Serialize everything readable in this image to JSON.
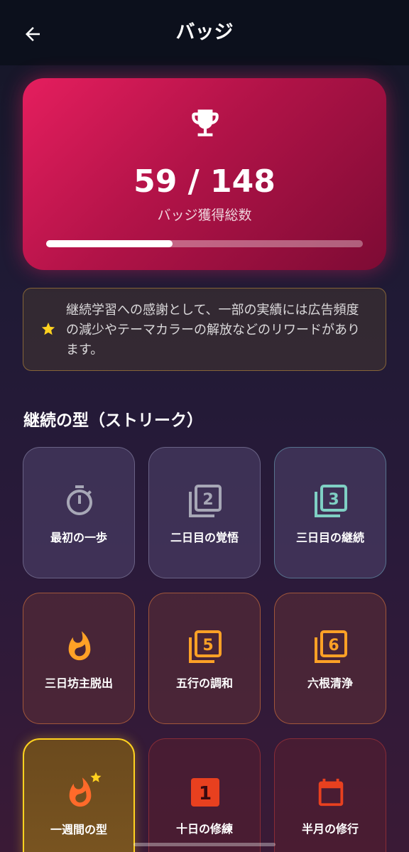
{
  "appbar": {
    "title": "バッジ",
    "back_icon": "arrow-left-icon"
  },
  "summary": {
    "icon": "trophy-icon",
    "count_text": "59 / 148",
    "earned": 59,
    "total": 148,
    "caption": "バッジ獲得総数",
    "progress": 0.4
  },
  "notice": {
    "icon": "star-icon",
    "text": "継続学習への感謝として、一部の実績には広告頻度の減少やテーマカラーの解放などのリワードがあります。"
  },
  "section": {
    "title": "継続の型（ストリーク）"
  },
  "badges": [
    {
      "label": "最初の一歩",
      "icon": "stopwatch-icon",
      "color": "#a7a7b6"
    },
    {
      "label": "二日目の覚悟",
      "icon": "filter-2-icon",
      "color": "#a7a7b6"
    },
    {
      "label": "三日目の継続",
      "icon": "filter-3-icon",
      "color": "#7fd0c4"
    },
    {
      "label": "三日坊主脱出",
      "icon": "flame-icon",
      "color": "#ffa126"
    },
    {
      "label": "五行の調和",
      "icon": "filter-5-icon",
      "color": "#ffa126"
    },
    {
      "label": "六根清浄",
      "icon": "filter-6-icon",
      "color": "#ffa126"
    },
    {
      "label": "一週間の型",
      "icon": "flame-star-icon",
      "color": "#ff6a2a"
    },
    {
      "label": "十日の修練",
      "icon": "calendar-1-icon",
      "color": "#e8401f"
    },
    {
      "label": "半月の修行",
      "icon": "calendar-icon",
      "color": "#e8401f"
    }
  ],
  "colors": {
    "hero_gradient_start": "#e51e5e",
    "hero_gradient_end": "#7d0b34",
    "gold_border": "#ffd21f",
    "star": "#ffd21f"
  }
}
